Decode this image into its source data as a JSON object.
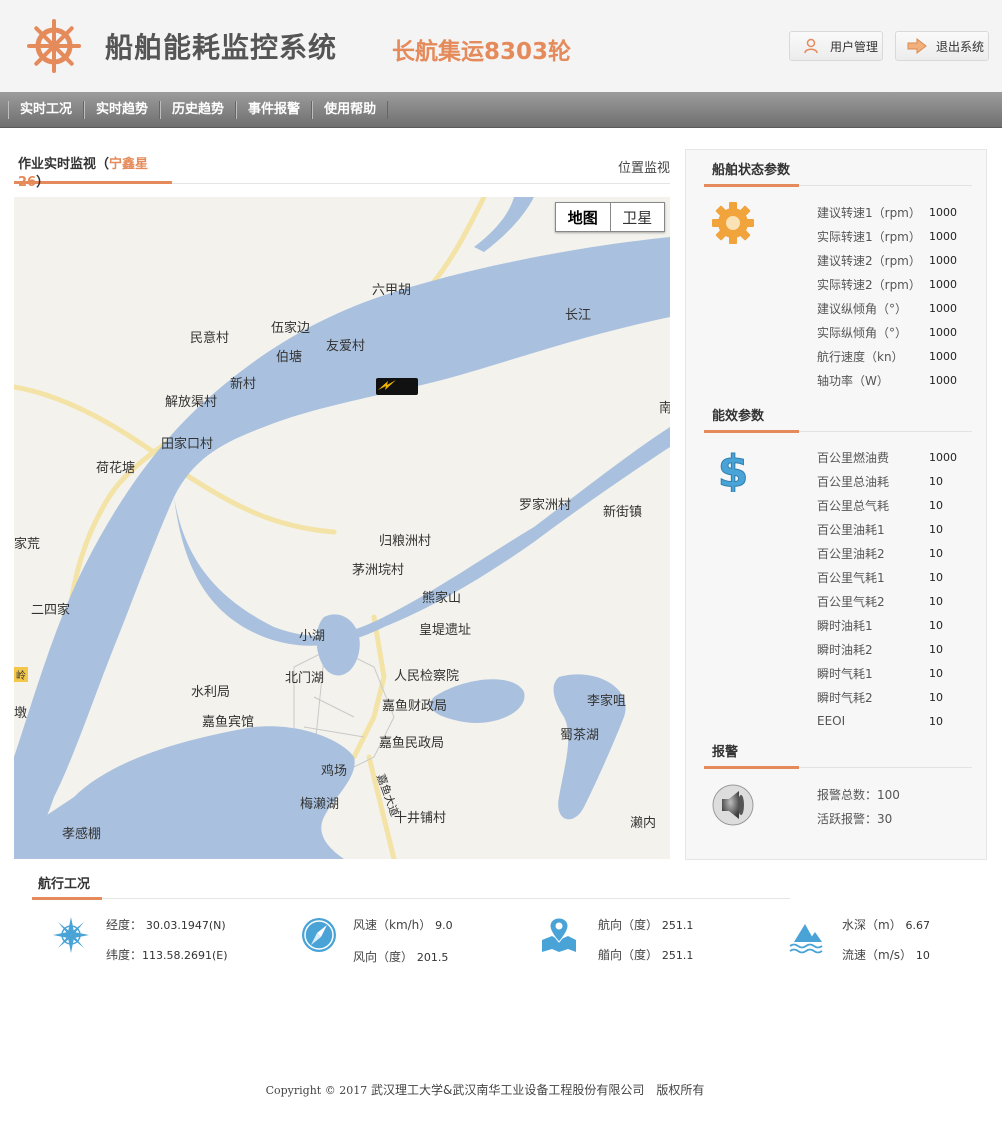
{
  "header": {
    "system_title": "船舶能耗监控系统",
    "ship_name": "长航集运8303轮",
    "user_button": "用户管理",
    "exit_button": "退出系统"
  },
  "nav": {
    "items": [
      "实时工况",
      "实时趋势",
      "历史趋势",
      "事件报警",
      "使用帮助"
    ]
  },
  "monitor": {
    "title_prefix": "作业实时监视（",
    "vessel": "宁鑫星26",
    "title_suffix": "）",
    "position_link": "位置监视"
  },
  "map": {
    "toggle_map": "地图",
    "toggle_satellite": "卫星",
    "labels": {
      "l1": "六甲胡",
      "l2": "长江",
      "l3": "民意村",
      "l4": "伍家边",
      "l5": "友爱村",
      "l6": "伯塘",
      "l7": "新村",
      "l8": "解放渠村",
      "l9": "田家口村",
      "l10": "荷花塘",
      "l11": "罗家洲村",
      "l12": "新街镇",
      "l13": "归粮洲村",
      "l14": "茅洲垸村",
      "l15": "熊家山",
      "l16": "皇堤遗址",
      "l17": "小湖",
      "l18": "北门湖",
      "l19": "人民检察院",
      "l20": "水利局",
      "l21": "嘉鱼财政局",
      "l22": "嘉鱼宾馆",
      "l23": "嘉鱼民政局",
      "l24": "李家咀",
      "l25": "蜀茶湖",
      "l26": "鸡场",
      "l27": "梅濑湖",
      "l28": "十井铺村",
      "l29": "孝感棚",
      "l30": "濑内",
      "l31": "家荒",
      "l32": "二四家",
      "l33": "嘉鱼大道",
      "l34": "南",
      "l35": "墩",
      "l36": "岭"
    }
  },
  "ship_status": {
    "title": "船舶状态参数",
    "rows": [
      {
        "k": "建议转速1（rpm）",
        "v": "1000"
      },
      {
        "k": "实际转速1（rpm）",
        "v": "1000"
      },
      {
        "k": "建议转速2（rpm）",
        "v": "1000"
      },
      {
        "k": "实际转速2（rpm）",
        "v": "1000"
      },
      {
        "k": "建议纵倾角（°）",
        "v": "1000"
      },
      {
        "k": "实际纵倾角（°）",
        "v": "1000"
      },
      {
        "k": "航行速度（kn）",
        "v": "1000"
      },
      {
        "k": "轴功率（W）",
        "v": "1000"
      }
    ]
  },
  "efficiency": {
    "title": "能效参数",
    "rows": [
      {
        "k": "百公里燃油费",
        "v": "1000"
      },
      {
        "k": "百公里总油耗",
        "v": "10"
      },
      {
        "k": "百公里总气耗",
        "v": "10"
      },
      {
        "k": "百公里油耗1",
        "v": "10"
      },
      {
        "k": "百公里油耗2",
        "v": "10"
      },
      {
        "k": "百公里气耗1",
        "v": "10"
      },
      {
        "k": "百公里气耗2",
        "v": "10"
      },
      {
        "k": "瞬时油耗1",
        "v": "10"
      },
      {
        "k": "瞬时油耗2",
        "v": "10"
      },
      {
        "k": "瞬时气耗1",
        "v": "10"
      },
      {
        "k": "瞬时气耗2",
        "v": "10"
      },
      {
        "k": "EEOI",
        "v": "10"
      }
    ]
  },
  "alarm": {
    "title": "报警",
    "total": "报警总数：100",
    "active": "活跃报警：30"
  },
  "sailing": {
    "title": "航行工况",
    "longitude_label": "经度：",
    "longitude_value": "30.03.1947(N)",
    "latitude_label": "纬度：",
    "latitude_value": "113.58.2691(E)",
    "wind_speed_label": "风速（km/h）",
    "wind_speed_value": "9.0",
    "wind_dir_label": "风向（度）",
    "wind_dir_value": "201.5",
    "course_label": "航向（度）",
    "course_value": "251.1",
    "heading_label": "艏向（度）",
    "heading_value": "251.1",
    "depth_label": "水深（m）",
    "depth_value": "6.67",
    "current_label": "流速（m/s）",
    "current_value": "10"
  },
  "footer": {
    "copyright_en": "Copyright © 2017",
    "copyright_cn": "武汉理工大学&武汉南华工业设备工程股份有限公司　版权所有"
  },
  "colors": {
    "accent": "#e58a5a",
    "water": "#a9c1de",
    "icon_blue": "#4aa3d6"
  }
}
